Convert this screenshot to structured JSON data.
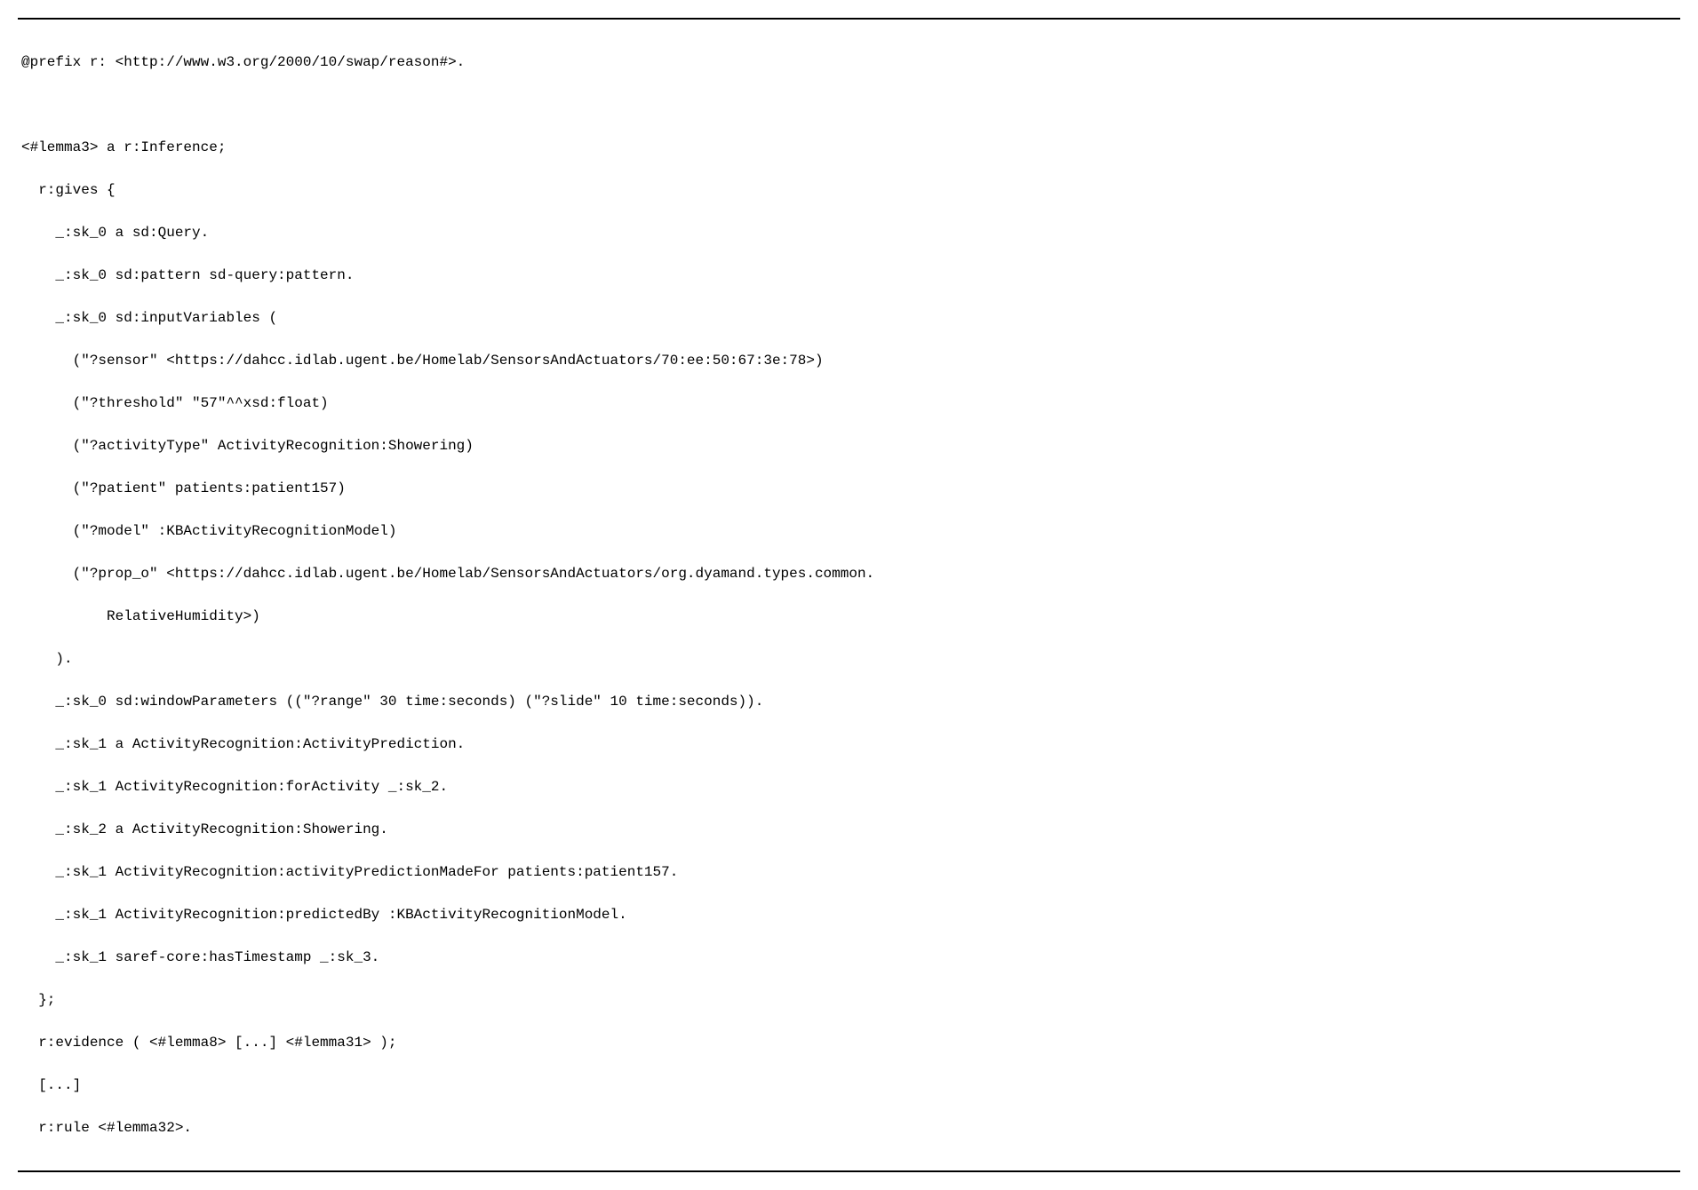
{
  "lines": {
    "prefix": "@prefix r: <http://www.w3.org/2000/10/swap/reason#>.",
    "lemma3": "<#lemma3> a r:Inference;",
    "gives": "r:gives {",
    "sk0a": "_:sk_0 a sd:Query.",
    "sk0pattern": "_:sk_0 sd:pattern sd-query:pattern.",
    "sk0input": "_:sk_0 sd:inputVariables (",
    "inSensor": "(\"?sensor\" <https://dahcc.idlab.ugent.be/Homelab/SensorsAndActuators/70:ee:50:67:3e:78>)",
    "inThreshold": "(\"?threshold\" \"57\"^^xsd:float)",
    "inActivityType": "(\"?activityType\" ActivityRecognition:Showering)",
    "inPatient": "(\"?patient\" patients:patient157)",
    "inModel": "(\"?model\" :KBActivityRecognitionModel)",
    "inPropO1": "(\"?prop_o\" <https://dahcc.idlab.ugent.be/Homelab/SensorsAndActuators/org.dyamand.types.common.",
    "inPropO2": "RelativeHumidity>)",
    "closeList": ").",
    "sk0window": "_:sk_0 sd:windowParameters ((\"?range\" 30 time:seconds) (\"?slide\" 10 time:seconds)).",
    "sk1a": "_:sk_1 a ActivityRecognition:ActivityPrediction.",
    "sk1for": "_:sk_1 ActivityRecognition:forActivity _:sk_2.",
    "sk2a": "_:sk_2 a ActivityRecognition:Showering.",
    "sk1made": "_:sk_1 ActivityRecognition:activityPredictionMadeFor patients:patient157.",
    "sk1pred": "_:sk_1 ActivityRecognition:predictedBy :KBActivityRecognitionModel.",
    "sk1ts": "_:sk_1 saref-core:hasTimestamp _:sk_3.",
    "closeGives": "};",
    "evidence": "r:evidence ( <#lemma8> [...] <#lemma31> );",
    "ellipsis": "[...]",
    "rule": "r:rule <#lemma32>."
  }
}
